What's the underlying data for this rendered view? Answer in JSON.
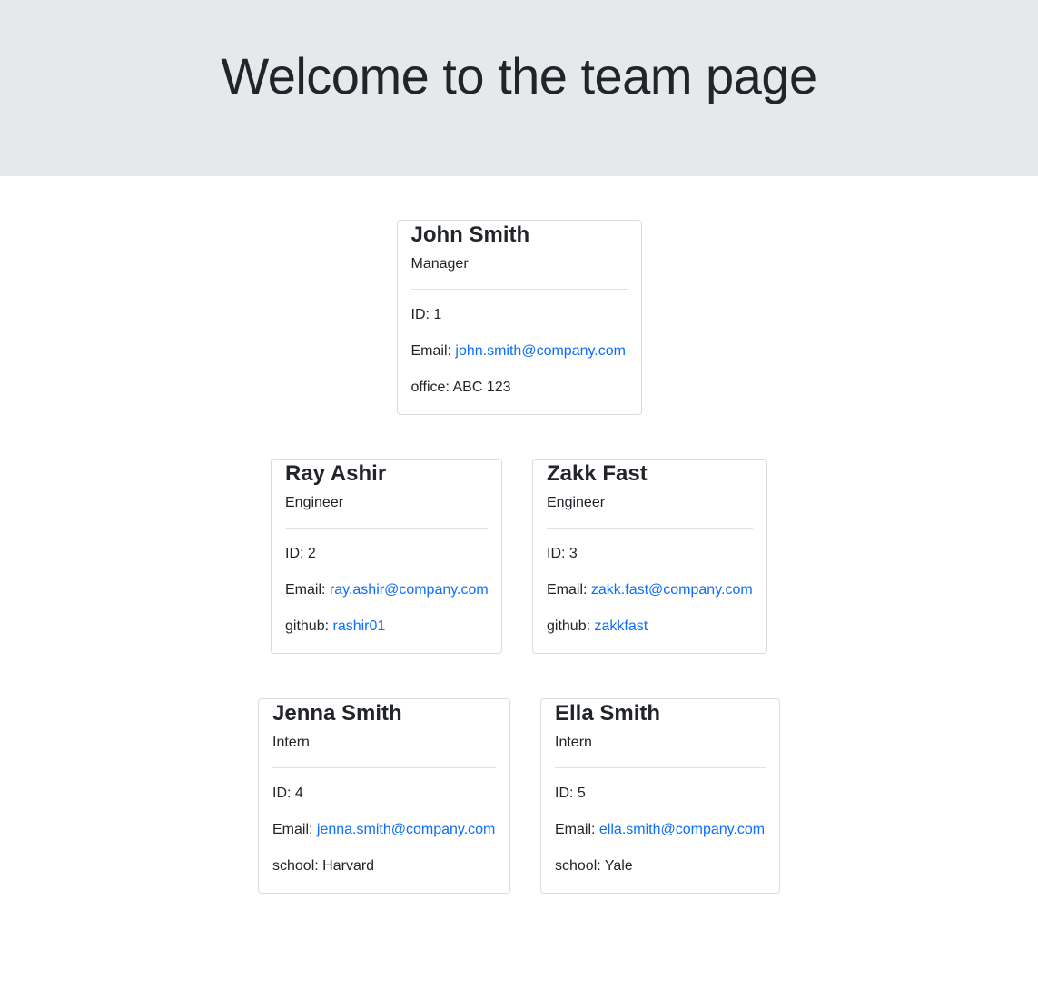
{
  "header": {
    "title": "Welcome to the team page"
  },
  "team": {
    "manager": {
      "name": "John Smith",
      "role": "Manager",
      "id_label": "ID:",
      "id": "1",
      "email_label": "Email:",
      "email": "john.smith@company.com",
      "extra_label": "office:",
      "extra": "ABC 123"
    },
    "engineers": [
      {
        "name": "Ray Ashir",
        "role": "Engineer",
        "id_label": "ID:",
        "id": "2",
        "email_label": "Email:",
        "email": "ray.ashir@company.com",
        "extra_label": "github:",
        "extra": "rashir01"
      },
      {
        "name": "Zakk Fast",
        "role": "Engineer",
        "id_label": "ID:",
        "id": "3",
        "email_label": "Email:",
        "email": "zakk.fast@company.com",
        "extra_label": "github:",
        "extra": "zakkfast"
      }
    ],
    "interns": [
      {
        "name": "Jenna Smith",
        "role": "Intern",
        "id_label": "ID:",
        "id": "4",
        "email_label": "Email:",
        "email": "jenna.smith@company.com",
        "extra_label": "school:",
        "extra": "Harvard"
      },
      {
        "name": "Ella Smith",
        "role": "Intern",
        "id_label": "ID:",
        "id": "5",
        "email_label": "Email:",
        "email": "ella.smith@company.com",
        "extra_label": "school:",
        "extra": "Yale"
      }
    ]
  },
  "colors": {
    "header_bg": "#e5e9ec",
    "link": "#0d6efd",
    "text": "#212529",
    "card_border": "#d9dcdf"
  }
}
